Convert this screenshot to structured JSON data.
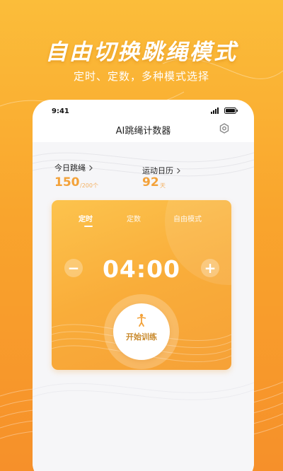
{
  "promo": {
    "headline": "自由切换跳绳模式",
    "subline": "定时、定数，多种模式选择"
  },
  "status_bar": {
    "time": "9:41",
    "icons": [
      "signal-5g-icon",
      "battery-icon"
    ]
  },
  "app": {
    "title": "AI跳绳计数器"
  },
  "stats": {
    "today": {
      "label": "今日跳绳",
      "value": "150",
      "unit": "/200个"
    },
    "calendar": {
      "label": "运动日历",
      "value": "92",
      "unit": "天"
    }
  },
  "timer_card": {
    "tabs": [
      {
        "label": "定时",
        "active": true
      },
      {
        "label": "定数",
        "active": false
      },
      {
        "label": "自由模式",
        "active": false
      }
    ],
    "minus_label": "−",
    "plus_label": "+",
    "time_value": "04:00",
    "start_label": "开始训练"
  },
  "colors": {
    "accent": "#f3a23a",
    "background_top": "#fbbd3a",
    "background_bottom": "#f6902a"
  }
}
